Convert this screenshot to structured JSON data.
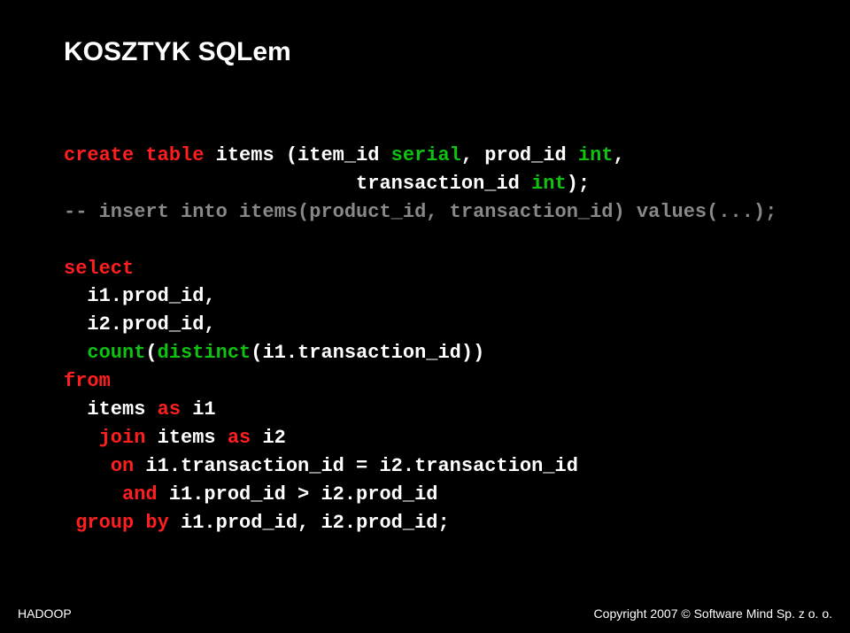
{
  "title": "KOSZTYK SQLem",
  "code": {
    "kw_create": "create",
    "kw_table": "table",
    "t1": " items (item_id ",
    "ty_serial": "serial",
    "t2": ", prod_id ",
    "ty_int1": "int",
    "t3": ",",
    "indent1": "                         transaction_id ",
    "ty_int2": "int",
    "t4": ");",
    "comment": "-- insert into items(product_id, transaction_id) values(...);",
    "kw_select": "select",
    "l_sel1": "  i1.prod_id,",
    "l_sel2": "  i2.prod_id,",
    "l_sel3a": "  ",
    "fn_count": "count",
    "l_sel3b": "(",
    "fn_dist": "distinct",
    "l_sel3c": "(i1.transaction_id))",
    "kw_from": "from",
    "l_from1": "  items ",
    "kw_as1": "as",
    "l_from1b": " i1",
    "l_join0": "   ",
    "kw_join": "join",
    "l_join1": " items ",
    "kw_as2": "as",
    "l_join1b": " i2",
    "l_on0": "    ",
    "kw_on": "on",
    "l_on1": " i1.transaction_id = i2.transaction_id",
    "l_and0": "     ",
    "kw_and": "and",
    "l_and1": " i1.prod_id > i2.prod_id",
    "l_grp0": " ",
    "kw_group": "group",
    "kw_by": "by",
    "l_grp1": " i1.prod_id, i2.prod_id;"
  },
  "footer": {
    "left": "HADOOP",
    "right": "Copyright 2007 © Software Mind Sp. z o. o."
  }
}
